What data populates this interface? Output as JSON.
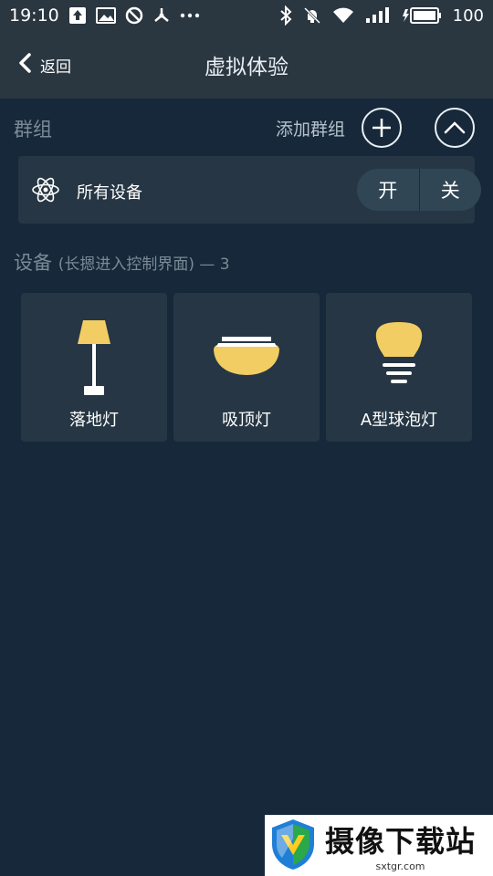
{
  "status_bar": {
    "time": "19:10",
    "battery": "100",
    "icons_left": [
      "upload-icon",
      "image-icon",
      "block-icon",
      "fan-icon",
      "more-icon"
    ],
    "icons_right": [
      "bluetooth-icon",
      "mute-icon",
      "wifi-icon",
      "signal-icon",
      "battery-icon"
    ]
  },
  "titlebar": {
    "back_label": "返回",
    "title": "虚拟体验"
  },
  "groups": {
    "label": "群组",
    "add_label": "添加群组",
    "items": [
      {
        "name": "所有设备",
        "icon": "atom-icon",
        "on_label": "开",
        "off_label": "关"
      }
    ]
  },
  "devices": {
    "label": "设备",
    "hint": "(长摁进入控制界面)",
    "count_text": " — 3",
    "items": [
      {
        "label": "落地灯",
        "icon": "floor-lamp-icon",
        "color": "#f2cd63"
      },
      {
        "label": "吸顶灯",
        "icon": "ceiling-lamp-icon",
        "color": "#f2cd63"
      },
      {
        "label": "A型球泡灯",
        "icon": "bulb-icon",
        "color": "#f2cd63"
      }
    ]
  },
  "watermark": {
    "title": "摄像下载站",
    "subtitle": "sxtgr.com"
  },
  "colors": {
    "background": "#16283a",
    "bar": "#2a3640",
    "card": "#263644",
    "accent": "#f2cd63"
  }
}
